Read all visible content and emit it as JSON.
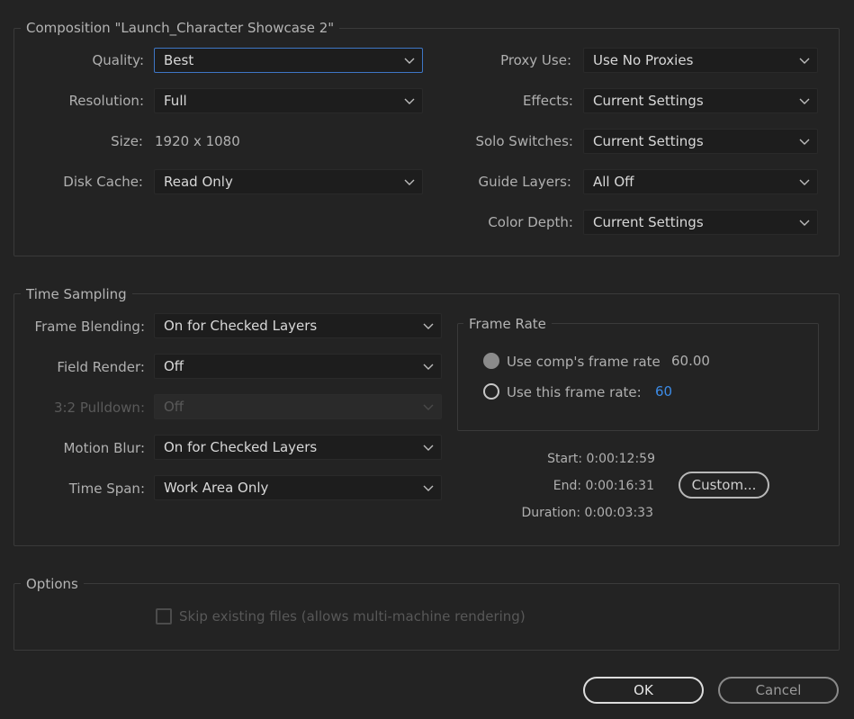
{
  "composition": {
    "title": "Composition \"Launch_Character Showcase 2\"",
    "quality_label": "Quality:",
    "quality_value": "Best",
    "resolution_label": "Resolution:",
    "resolution_value": "Full",
    "size_label": "Size:",
    "size_value": "1920 x 1080",
    "disk_cache_label": "Disk Cache:",
    "disk_cache_value": "Read Only",
    "proxy_use_label": "Proxy Use:",
    "proxy_use_value": "Use No Proxies",
    "effects_label": "Effects:",
    "effects_value": "Current Settings",
    "solo_switches_label": "Solo Switches:",
    "solo_switches_value": "Current Settings",
    "guide_layers_label": "Guide Layers:",
    "guide_layers_value": "All Off",
    "color_depth_label": "Color Depth:",
    "color_depth_value": "Current Settings"
  },
  "time_sampling": {
    "title": "Time Sampling",
    "frame_blending_label": "Frame Blending:",
    "frame_blending_value": "On for Checked Layers",
    "field_render_label": "Field Render:",
    "field_render_value": "Off",
    "pulldown_label": "3:2 Pulldown:",
    "pulldown_value": "Off",
    "motion_blur_label": "Motion Blur:",
    "motion_blur_value": "On for Checked Layers",
    "time_span_label": "Time Span:",
    "time_span_value": "Work Area Only",
    "frame_rate": {
      "title": "Frame Rate",
      "use_comp_label": "Use comp's frame rate",
      "use_comp_value": "60.00",
      "use_this_label": "Use this frame rate:",
      "use_this_value": "60"
    },
    "start_label": "Start: 0:00:12:59",
    "end_label": "End: 0:00:16:31",
    "duration_label": "Duration: 0:00:03:33",
    "custom_button": "Custom..."
  },
  "options": {
    "title": "Options",
    "skip_existing_label": "Skip existing files (allows multi-machine rendering)"
  },
  "footer": {
    "ok_label": "OK",
    "cancel_label": "Cancel"
  },
  "colors": {
    "background": "#232323",
    "focus_border": "#3e76c6",
    "accent_value": "#3c8be6"
  }
}
